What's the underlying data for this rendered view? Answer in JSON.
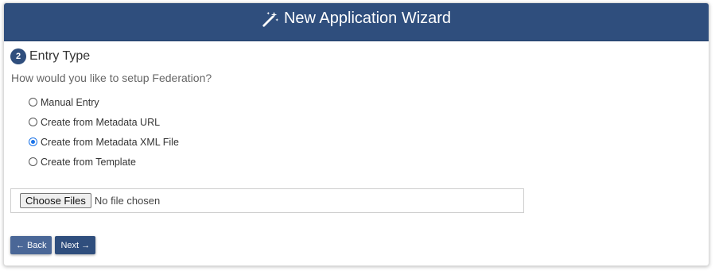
{
  "header": {
    "title": "New Application Wizard",
    "icon": "magic-wand-icon",
    "bg_color": "#2f4e7d"
  },
  "step": {
    "number": "2",
    "title": "Entry Type"
  },
  "question": "How would you like to setup Federation?",
  "options": [
    {
      "label": "Manual Entry",
      "checked": false
    },
    {
      "label": "Create from Metadata URL",
      "checked": false
    },
    {
      "label": "Create from Metadata XML File",
      "checked": true
    },
    {
      "label": "Create from Template",
      "checked": false
    }
  ],
  "file_input": {
    "button_label": "Choose Files",
    "status": "No file chosen"
  },
  "buttons": {
    "back_label": "Back",
    "back_icon": "arrow-left-icon",
    "next_label": "Next",
    "next_icon": "arrow-right-icon"
  }
}
